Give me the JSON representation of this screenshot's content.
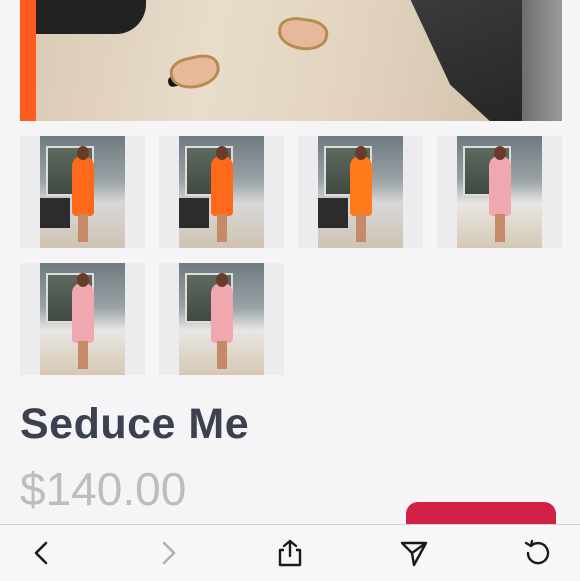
{
  "product": {
    "title": "Seduce Me",
    "price": "$140.00"
  },
  "thumbnails": [
    {
      "name": "thumb-1",
      "dress_color": "#ff6a1a"
    },
    {
      "name": "thumb-2",
      "dress_color": "#ff6a1a"
    },
    {
      "name": "thumb-3",
      "dress_color": "#ff7a1a"
    },
    {
      "name": "thumb-4",
      "dress_color": "#f1a7b0"
    },
    {
      "name": "thumb-5",
      "dress_color": "#f1a7b0"
    },
    {
      "name": "thumb-6",
      "dress_color": "#f1a7b0"
    }
  ],
  "cta": {
    "label": ""
  },
  "toolbar": {
    "icons": [
      "back-icon",
      "forward-icon",
      "share-icon",
      "send-icon",
      "reload-icon"
    ]
  },
  "colors": {
    "accent": "#d11f45",
    "title": "#3c4150",
    "price": "#bdbdbd",
    "background": "#f5f5f7"
  }
}
